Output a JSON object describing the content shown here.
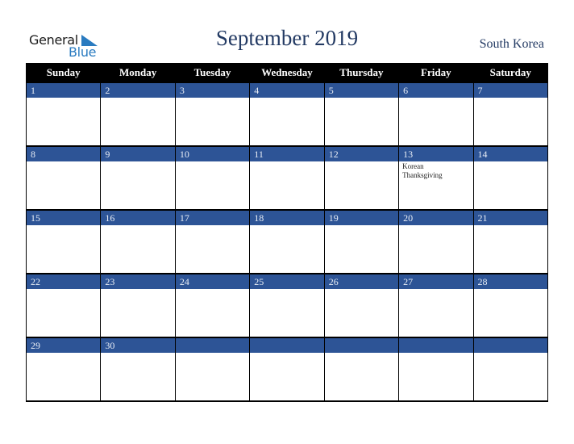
{
  "logo": {
    "line1": "General",
    "line2": "Blue"
  },
  "header": {
    "title": "September 2019",
    "country": "South Korea"
  },
  "colors": {
    "header_bg": "#000000",
    "date_band": "#2d5496",
    "title": "#233a63",
    "logo_blue": "#2a7bc0"
  },
  "weekdays": [
    "Sunday",
    "Monday",
    "Tuesday",
    "Wednesday",
    "Thursday",
    "Friday",
    "Saturday"
  ],
  "weeks": [
    {
      "days": [
        {
          "date": "1",
          "event": ""
        },
        {
          "date": "2",
          "event": ""
        },
        {
          "date": "3",
          "event": ""
        },
        {
          "date": "4",
          "event": ""
        },
        {
          "date": "5",
          "event": ""
        },
        {
          "date": "6",
          "event": ""
        },
        {
          "date": "7",
          "event": ""
        }
      ]
    },
    {
      "days": [
        {
          "date": "8",
          "event": ""
        },
        {
          "date": "9",
          "event": ""
        },
        {
          "date": "10",
          "event": ""
        },
        {
          "date": "11",
          "event": ""
        },
        {
          "date": "12",
          "event": ""
        },
        {
          "date": "13",
          "event": "Korean Thanksgiving"
        },
        {
          "date": "14",
          "event": ""
        }
      ]
    },
    {
      "days": [
        {
          "date": "15",
          "event": ""
        },
        {
          "date": "16",
          "event": ""
        },
        {
          "date": "17",
          "event": ""
        },
        {
          "date": "18",
          "event": ""
        },
        {
          "date": "19",
          "event": ""
        },
        {
          "date": "20",
          "event": ""
        },
        {
          "date": "21",
          "event": ""
        }
      ]
    },
    {
      "days": [
        {
          "date": "22",
          "event": ""
        },
        {
          "date": "23",
          "event": ""
        },
        {
          "date": "24",
          "event": ""
        },
        {
          "date": "25",
          "event": ""
        },
        {
          "date": "26",
          "event": ""
        },
        {
          "date": "27",
          "event": ""
        },
        {
          "date": "28",
          "event": ""
        }
      ]
    },
    {
      "days": [
        {
          "date": "29",
          "event": ""
        },
        {
          "date": "30",
          "event": ""
        },
        {
          "date": "",
          "event": ""
        },
        {
          "date": "",
          "event": ""
        },
        {
          "date": "",
          "event": ""
        },
        {
          "date": "",
          "event": ""
        },
        {
          "date": "",
          "event": ""
        }
      ]
    }
  ]
}
